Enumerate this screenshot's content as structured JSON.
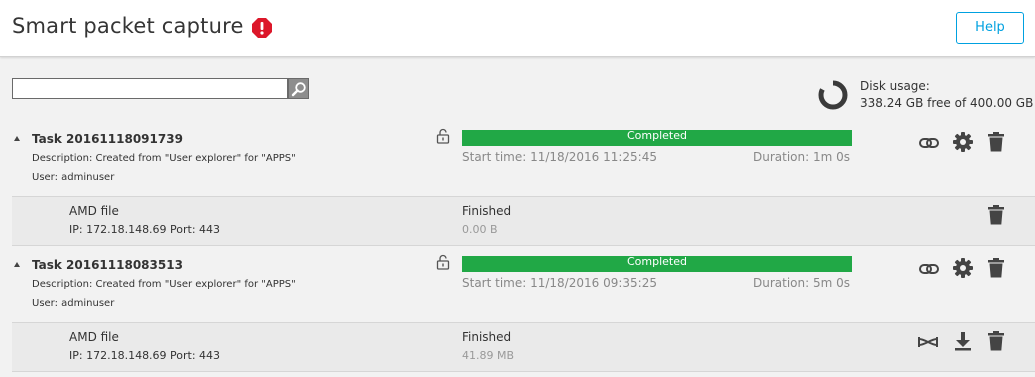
{
  "header": {
    "title": "Smart packet capture",
    "help_label": "Help"
  },
  "search": {
    "value": "",
    "placeholder": ""
  },
  "disk": {
    "title": "Disk usage:",
    "value": "338.24 GB free of 400.00 GB"
  },
  "tasks": [
    {
      "name": "Task 20161118091739",
      "description": "Description: Created from \"User explorer\" for \"APPS\"",
      "user": "User: adminuser",
      "status": "Completed",
      "progress": 1.0,
      "start_time": "Start time: 11/18/2016 11:25:45",
      "duration": "Duration: 1m 0s",
      "file": {
        "name": "AMD file",
        "ip": "IP: 172.18.148.69 Port: 443",
        "status": "Finished",
        "size": "0.00 B"
      }
    },
    {
      "name": "Task 20161118083513",
      "description": "Description: Created from \"User explorer\" for \"APPS\"",
      "user": "User: adminuser",
      "status": "Completed",
      "progress": 1.0,
      "start_time": "Start time: 11/18/2016 09:35:25",
      "duration": "Duration: 5m 0s",
      "file": {
        "name": "AMD file",
        "ip": "IP: 172.18.148.69 Port: 443",
        "status": "Finished",
        "size": "41.89 MB"
      }
    }
  ],
  "icons": {
    "warning": "exclamation-circle-icon",
    "search": "magnifier-icon",
    "disk": "donut-chart-icon",
    "lock": "unlocked-padlock-icon",
    "link": "link-icon",
    "settings": "gear-icon",
    "delete": "trash-icon",
    "analyze": "network-trace-icon",
    "download": "download-icon"
  },
  "colors": {
    "accent": "#00a1e0",
    "progress": "#21a846",
    "warning": "#dc172a"
  }
}
